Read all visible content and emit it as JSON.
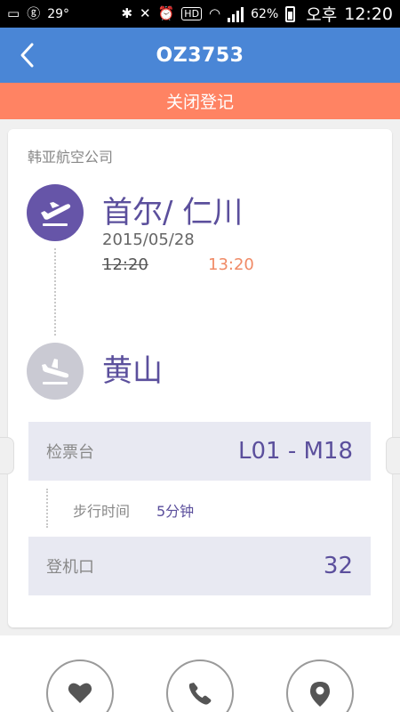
{
  "status_bar": {
    "battery": "62%",
    "temperature": "29°",
    "ampm": "오후",
    "time": "12:20",
    "hd": "HD"
  },
  "header": {
    "title": "OZ3753"
  },
  "banner": {
    "text": "关闭登记"
  },
  "flight": {
    "airline": "韩亚航空公司",
    "departure_city": "首尔/ 仁川",
    "date": "2015/05/28",
    "scheduled_time": "12:20",
    "actual_time": "13:20",
    "arrival_city": "黄山"
  },
  "checkin": {
    "counter_label": "检票台",
    "counter_value": "L01 - M18",
    "walk_label": "步行时间",
    "walk_value": "5分钟",
    "gate_label": "登机口",
    "gate_value": "32"
  },
  "colors": {
    "header": "#4a86d6",
    "banner": "#ff8363",
    "accent_purple": "#5b4f9c",
    "departure_icon_bg": "#6655a8",
    "arrival_icon_bg": "#cacad3",
    "delayed_time": "#f08a66"
  },
  "icons": {
    "back": "chevron-left-icon",
    "departure": "plane-takeoff-icon",
    "arrival": "plane-landing-icon",
    "favorite": "heart-icon",
    "call": "phone-icon",
    "location": "map-pin-icon"
  }
}
